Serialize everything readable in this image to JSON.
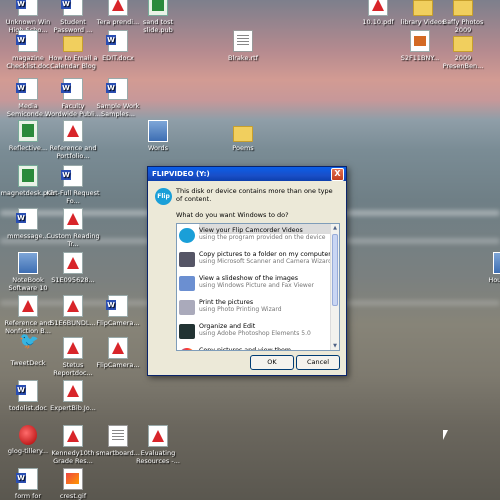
{
  "desktop": {
    "icons": [
      {
        "label": "Unknown Win High Scho...",
        "kind": "word"
      },
      {
        "label": "Student Password ...",
        "kind": "word"
      },
      {
        "label": "Tera prendi...",
        "kind": "pdf"
      },
      {
        "label": "sand tost slide.pub",
        "kind": "pub"
      },
      {
        "label": "10.10.pdf",
        "kind": "pdf"
      },
      {
        "label": "library Videos",
        "kind": "folder"
      },
      {
        "label": "Baffy Photos 2009",
        "kind": "folder"
      },
      {
        "label": "magazine Checklist.doc",
        "kind": "word"
      },
      {
        "label": "How to Email a Calendar Blog",
        "kind": "folder"
      },
      {
        "label": "EDIT.docx",
        "kind": "word"
      },
      {
        "label": "Blrake.rtf",
        "kind": "textfile"
      },
      {
        "label": "S2F11BNY...",
        "kind": "ppt"
      },
      {
        "label": "2009 PresenBen...",
        "kind": "folder"
      },
      {
        "label": "Media Semiconde...",
        "kind": "word"
      },
      {
        "label": "Faculty Wordwide Publi...",
        "kind": "word"
      },
      {
        "label": "Sample Work Samples...",
        "kind": "word"
      },
      {
        "label": "Reflective...",
        "kind": "pub"
      },
      {
        "label": "Reference and Portfolio...",
        "kind": "pdf"
      },
      {
        "label": "Words",
        "kind": "img"
      },
      {
        "label": "Poems",
        "kind": "folder"
      },
      {
        "label": "magnetdesk.pub",
        "kind": "pub"
      },
      {
        "label": "Kirt-Full Request Fo...",
        "kind": "word"
      },
      {
        "label": "mmessage...",
        "kind": "word"
      },
      {
        "label": "Custom Reading Tr...",
        "kind": "pdf"
      },
      {
        "label": "NoteBook Software 10",
        "kind": "img"
      },
      {
        "label": "S1E095628...",
        "kind": "pdf"
      },
      {
        "label": "Reference and Nonfiction B...",
        "kind": "pdf"
      },
      {
        "label": "S1E6BUNDL...",
        "kind": "pdf"
      },
      {
        "label": "FlipCamera...",
        "kind": "word"
      },
      {
        "label": "TweetDeck",
        "kind": "bird"
      },
      {
        "label": "Stetus Reportdoc...",
        "kind": "pdf"
      },
      {
        "label": "FlipCamera...",
        "kind": "pdf"
      },
      {
        "label": "todolist.doc",
        "kind": "word"
      },
      {
        "label": "ExpertBib.Jo...",
        "kind": "pdf"
      },
      {
        "label": "glog-tillery...",
        "kind": "glog"
      },
      {
        "label": "Kennedy10th Grade Res...",
        "kind": "pdf"
      },
      {
        "label": "smartboard...",
        "kind": "textfile"
      },
      {
        "label": "Evaluating Resources -...",
        "kind": "pdf"
      },
      {
        "label": "form for",
        "kind": "word"
      },
      {
        "label": "crest.gif",
        "kind": "web"
      },
      {
        "label": "Hou Cole",
        "kind": "img"
      }
    ]
  },
  "dialog": {
    "title": "FLIPVIDEO (Y:)",
    "close_glyph": "X",
    "logo_text": "Flip",
    "message": "This disk or device contains more than one type of content.",
    "question": "What do you want Windows to do?",
    "options": [
      {
        "line1": "View your Flip Camcorder Videos",
        "line2": "using the program provided on the device",
        "icon": "flip-icon",
        "selected": true
      },
      {
        "line1": "Copy pictures to a folder on my computer",
        "line2": "using Microsoft Scanner and Camera Wizard",
        "icon": "camera-icon",
        "selected": false
      },
      {
        "line1": "View a slideshow of the images",
        "line2": "using Windows Picture and Fax Viewer",
        "icon": "slideshow-icon",
        "selected": false
      },
      {
        "line1": "Print the pictures",
        "line2": "using Photo Printing Wizard",
        "icon": "printer-icon",
        "selected": false
      },
      {
        "line1": "Organize and Edit",
        "line2": "using Adobe Photoshop Elements 5.0",
        "icon": "photoshop-icon",
        "selected": false
      },
      {
        "line1": "Copy pictures and view them",
        "line2": "",
        "icon": "copy-view-icon",
        "selected": false
      }
    ],
    "ok_label": "OK",
    "cancel_label": "Cancel"
  }
}
